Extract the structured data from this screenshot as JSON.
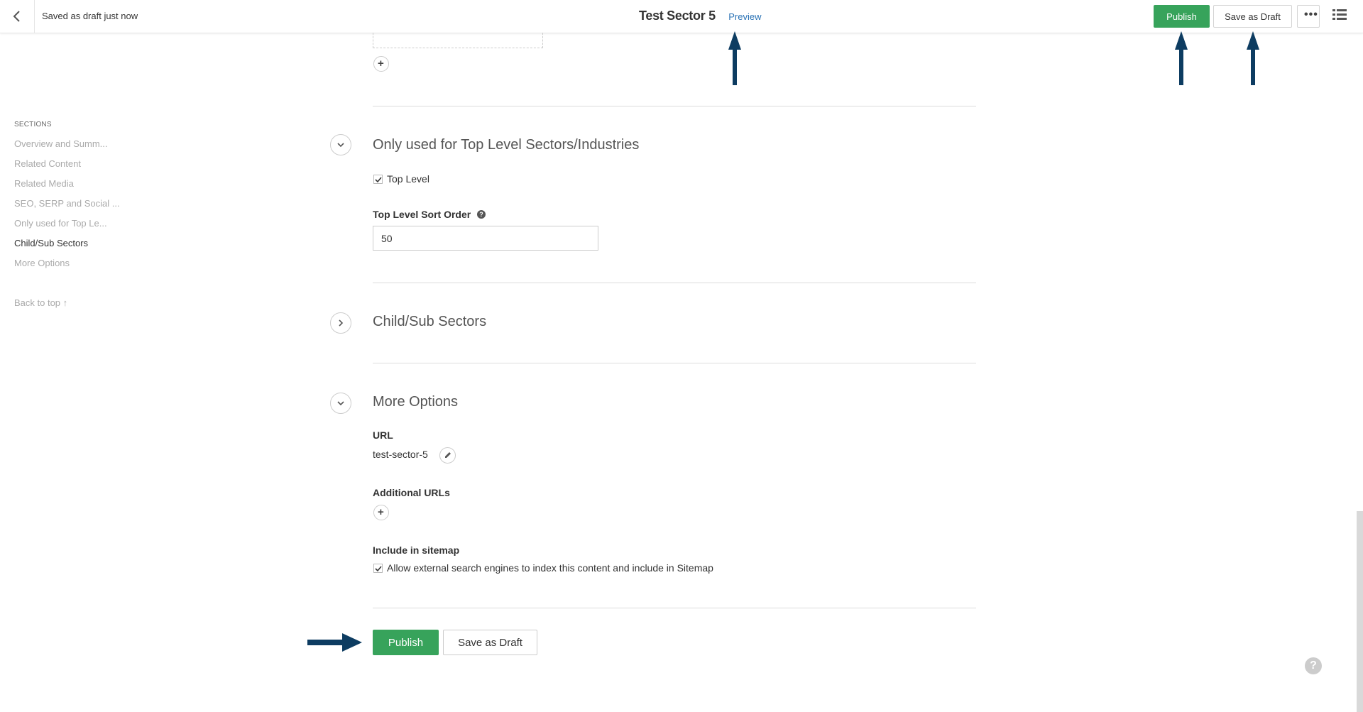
{
  "header": {
    "draft_status": "Saved as draft just now",
    "title": "Test Sector 5",
    "preview_label": "Preview",
    "publish_label": "Publish",
    "save_draft_label": "Save as Draft",
    "more_label": "•••"
  },
  "sidebar": {
    "heading": "SECTIONS",
    "items": [
      {
        "label": "Overview and Summ..."
      },
      {
        "label": "Related Content"
      },
      {
        "label": "Related Media"
      },
      {
        "label": "SEO, SERP and Social ..."
      },
      {
        "label": "Only used for Top Le..."
      },
      {
        "label": "Child/Sub Sectors"
      },
      {
        "label": "More Options"
      }
    ],
    "back_to_top": "Back to top ↑"
  },
  "sections": {
    "top_level": {
      "title": "Only used for Top Level Sectors/Industries",
      "checkbox_label": "Top Level",
      "sort_order_label": "Top Level Sort Order",
      "sort_order_value": "50"
    },
    "child_sub": {
      "title": "Child/Sub Sectors"
    },
    "more_options": {
      "title": "More Options",
      "url_label": "URL",
      "url_value": "test-sector-5",
      "additional_urls_label": "Additional URLs",
      "sitemap_label": "Include in sitemap",
      "sitemap_checkbox_label": "Allow external search engines to index this content and include in Sitemap"
    }
  },
  "footer": {
    "publish_label": "Publish",
    "save_draft_label": "Save as Draft"
  },
  "colors": {
    "publish_green": "#37a35b",
    "link_blue": "#2b73b6",
    "arrow_navy": "#0d3c61"
  }
}
